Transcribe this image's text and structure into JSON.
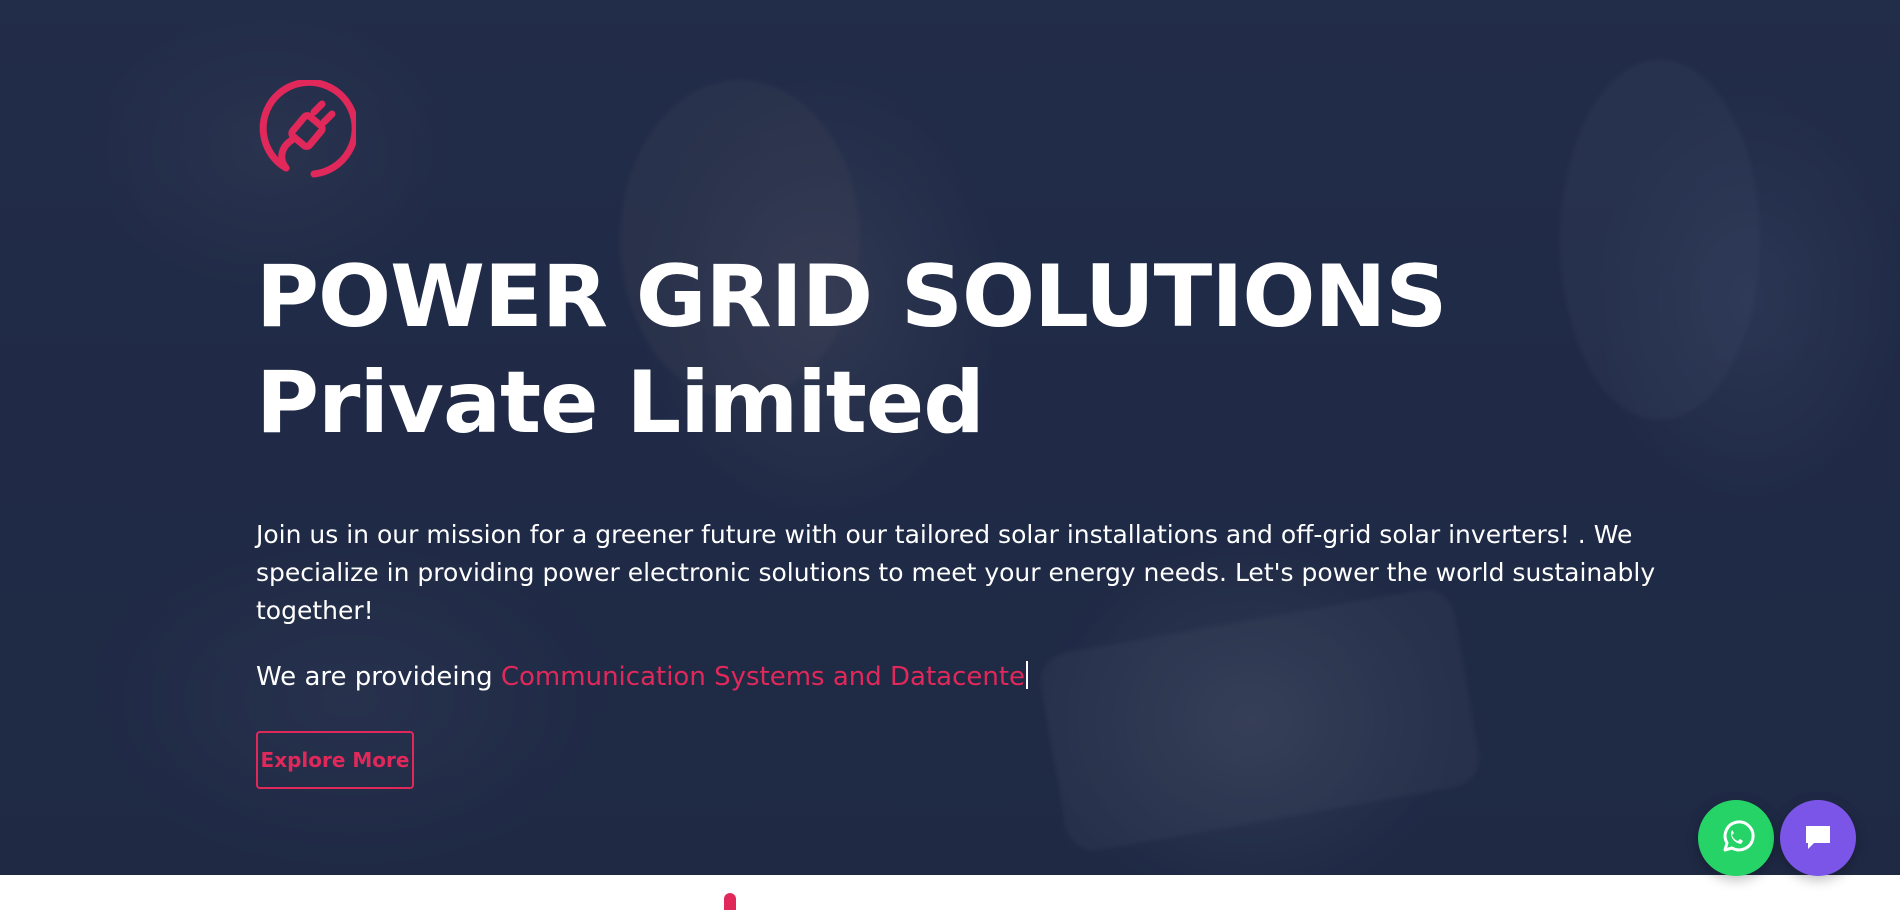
{
  "hero": {
    "title_line1": "POWER GRID SOLUTIONS",
    "title_line2": "Private Limited",
    "description": "Join us in our mission for a greener future with our tailored solar installations and off-grid solar inverters! . We specialize in providing power electronic solutions to meet your energy needs. Let's power the world sustainably together!",
    "typing_prefix": "We are provideing ",
    "typing_text": "Communication Systems and Datacente",
    "cta_label": "Explore More"
  },
  "icons": {
    "logo": "plug-logo-icon",
    "whatsapp": "whatsapp-icon",
    "chat": "chat-bubble-icon"
  },
  "colors": {
    "accent": "#e0285a",
    "hero_bg": "#1f2944",
    "whatsapp": "#25d366",
    "chat": "#7b55e8"
  }
}
